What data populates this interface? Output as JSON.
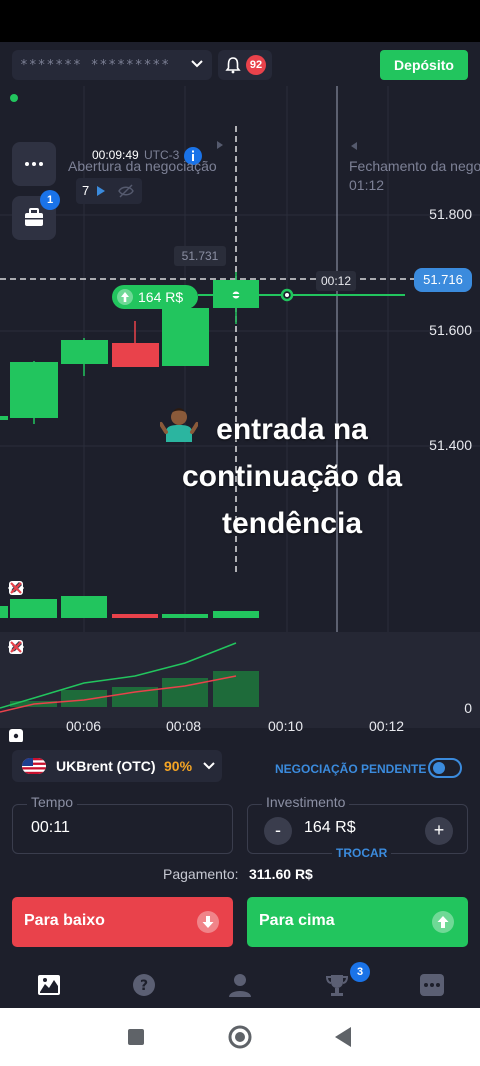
{
  "topbar": {
    "account_mask": "******* *********",
    "notifications_count": "92",
    "deposit_label": "Depósito"
  },
  "chart": {
    "open_time": "00:09:49",
    "open_utc": "UTC-3",
    "open_label": "Abertura da negociação",
    "close_label": "Fechamento da nego",
    "close_time": "01:12",
    "count": "7",
    "portfolio_badge": "1",
    "price_labels": [
      "51.800",
      "51.600",
      "51.400"
    ],
    "current_price": "51.716",
    "hover_price": "51.731",
    "cursor_time": "00:12",
    "trade_amount": "164 R$",
    "overlay_line1": "entrada na",
    "overlay_line2": "continuação da",
    "overlay_line3": "tendência",
    "indicator_zero": "0",
    "time_axis": [
      "00:06",
      "00:08",
      "00:10",
      "00:12"
    ],
    "colors": {
      "up": "#22c55e",
      "down": "#e9424b",
      "accent": "#3b8bdd"
    }
  },
  "controls": {
    "asset_name": "UKBrent (OTC)",
    "asset_payout": "90%",
    "pending_label": "NEGOCIAÇÃO PENDENTE",
    "time_label": "Tempo",
    "time_value": "00:11",
    "invest_label": "Investimento",
    "invest_value": "164 R$",
    "minus": "-",
    "plus": "+",
    "swap_label": "TROCAR",
    "payout_label": "Pagamento:",
    "payout_value": "311.60 R$",
    "down_label": "Para baixo",
    "up_label": "Para cima"
  },
  "navbar": {
    "items": [
      "chart-icon",
      "help-icon",
      "profile-icon",
      "trophy-icon",
      "more-icon"
    ],
    "trophy_badge": "3"
  }
}
